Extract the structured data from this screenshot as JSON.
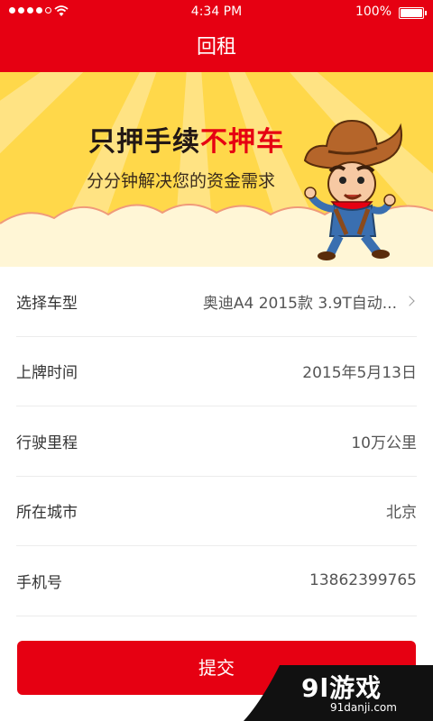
{
  "status": {
    "time": "4:34 PM",
    "battery": "100%"
  },
  "nav": {
    "title": "回租"
  },
  "banner": {
    "headline_black": "只押手续",
    "headline_red": "不押车",
    "subline": "分分钟解决您的资金需求"
  },
  "form": {
    "rows": [
      {
        "label": "选择车型",
        "value": "奥迪A4 2015款 3.9T自动...",
        "has_chevron": true
      },
      {
        "label": "上牌时间",
        "value": "2015年5月13日"
      },
      {
        "label": "行驶里程",
        "value": "10万公里"
      },
      {
        "label": "所在城市",
        "value": "北京"
      },
      {
        "label": "手机号",
        "value": "13862399765"
      }
    ]
  },
  "submit": {
    "label": "提交"
  },
  "watermark": {
    "brand": "9l游戏",
    "site": "91danji.com"
  },
  "colors": {
    "primary": "#e60012",
    "banner_yellow": "#ffd84a"
  },
  "icons": [
    "wifi-icon",
    "battery-icon",
    "chevron-right-icon",
    "cowboy-illustration"
  ]
}
